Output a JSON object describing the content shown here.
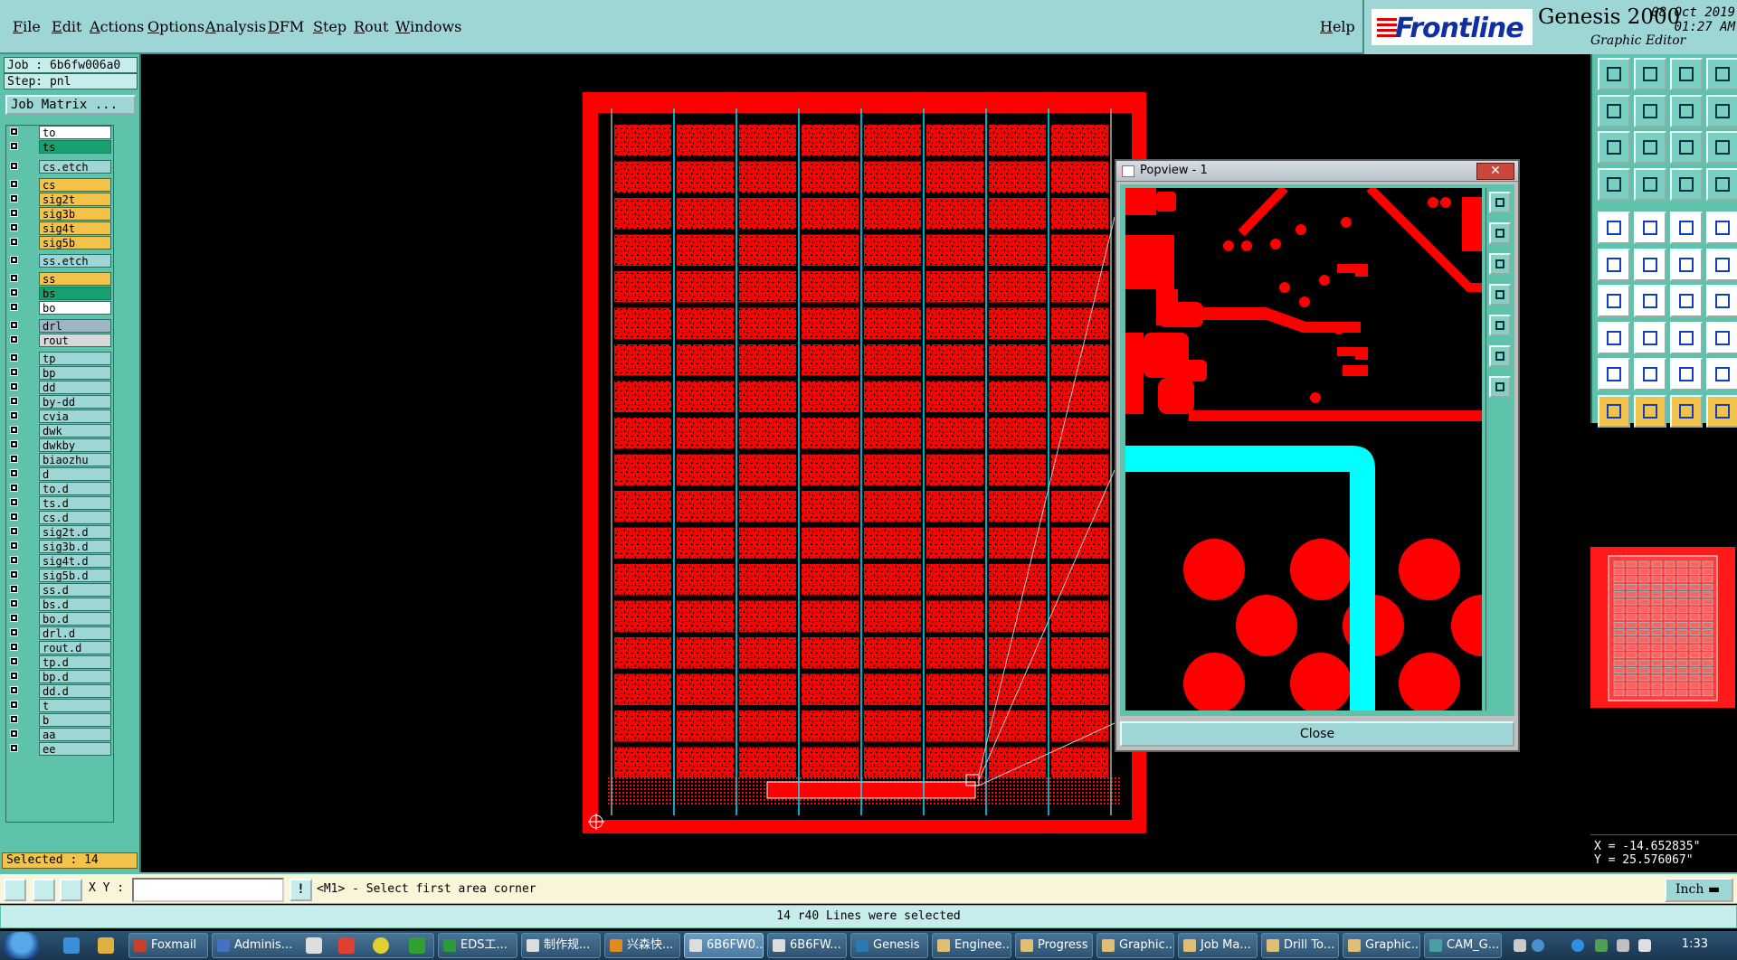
{
  "menu": {
    "items": [
      "File",
      "Edit",
      "Actions",
      "Options",
      "Analysis",
      "DFM",
      "Step",
      "Rout",
      "Windows"
    ],
    "help": "Help"
  },
  "brand": {
    "logo_text": "Frontline",
    "product": "Genesis 2000",
    "subtitle": "Graphic Editor",
    "date": "08 Oct 2019",
    "time": "01:27 AM"
  },
  "job": {
    "job_label": "Job : 6b6fw006a0",
    "step_label": "Step: pnl",
    "job_matrix_button": "Job Matrix ..."
  },
  "layers": [
    {
      "name": "to",
      "color": "#ffffff"
    },
    {
      "name": "ts",
      "color": "#1aa06e"
    },
    {
      "name": "cs.etch",
      "color": "#9ed6d6"
    },
    {
      "name": "cs",
      "color": "#f3c24b"
    },
    {
      "name": "sig2t",
      "color": "#f3c24b"
    },
    {
      "name": "sig3b",
      "color": "#f3c24b"
    },
    {
      "name": "sig4t",
      "color": "#f3c24b"
    },
    {
      "name": "sig5b",
      "color": "#f3c24b"
    },
    {
      "name": "ss.etch",
      "color": "#9ed6d6"
    },
    {
      "name": "ss",
      "color": "#f3c24b"
    },
    {
      "name": "bs",
      "color": "#1aa06e"
    },
    {
      "name": "bo",
      "color": "#ffffff"
    },
    {
      "name": "drl",
      "color": "#9fb7c4"
    },
    {
      "name": "rout",
      "color": "#d8d8d8"
    },
    {
      "name": "tp",
      "color": "#9ed6d6"
    },
    {
      "name": "bp",
      "color": "#9ed6d6"
    },
    {
      "name": "dd",
      "color": "#9ed6d6"
    },
    {
      "name": "by-dd",
      "color": "#9ed6d6"
    },
    {
      "name": "cvia",
      "color": "#9ed6d6"
    },
    {
      "name": "dwk",
      "color": "#9ed6d6"
    },
    {
      "name": "dwkby",
      "color": "#9ed6d6"
    },
    {
      "name": "biaozhu",
      "color": "#9ed6d6"
    },
    {
      "name": "d",
      "color": "#9ed6d6"
    },
    {
      "name": "to.d",
      "color": "#9ed6d6"
    },
    {
      "name": "ts.d",
      "color": "#9ed6d6"
    },
    {
      "name": "cs.d",
      "color": "#9ed6d6"
    },
    {
      "name": "sig2t.d",
      "color": "#9ed6d6"
    },
    {
      "name": "sig3b.d",
      "color": "#9ed6d6"
    },
    {
      "name": "sig4t.d",
      "color": "#9ed6d6"
    },
    {
      "name": "sig5b.d",
      "color": "#9ed6d6"
    },
    {
      "name": "ss.d",
      "color": "#9ed6d6"
    },
    {
      "name": "bs.d",
      "color": "#9ed6d6"
    },
    {
      "name": "bo.d",
      "color": "#9ed6d6"
    },
    {
      "name": "drl.d",
      "color": "#9ed6d6"
    },
    {
      "name": "rout.d",
      "color": "#9ed6d6"
    },
    {
      "name": "tp.d",
      "color": "#9ed6d6"
    },
    {
      "name": "bp.d",
      "color": "#9ed6d6"
    },
    {
      "name": "dd.d",
      "color": "#9ed6d6"
    },
    {
      "name": "t",
      "color": "#9ed6d6"
    },
    {
      "name": "b",
      "color": "#9ed6d6"
    },
    {
      "name": "aa",
      "color": "#9ed6d6"
    },
    {
      "name": "ee",
      "color": "#9ed6d6"
    }
  ],
  "selected_label": "Selected : 14",
  "popview": {
    "title": "Popview - 1",
    "close_label": "Close"
  },
  "coords": {
    "x": "X = -14.652835\"",
    "y": "Y = 25.576067\""
  },
  "command": {
    "xy_label": "X Y :",
    "xy_value": "",
    "prompt": "<M1> - Select first area corner",
    "units": "Inch"
  },
  "status": "14 r40 Lines were selected",
  "taskbar": {
    "tasks": [
      {
        "label": "Foxmail",
        "color": "#c8402a"
      },
      {
        "label": "Adminis...",
        "color": "#4470c8"
      },
      {
        "label": "EDS工...",
        "color": "#2a9a3a"
      },
      {
        "label": "制作规...",
        "color": "#dddddd"
      },
      {
        "label": "兴森快...",
        "color": "#e08a20"
      },
      {
        "label": "6B6FW0...",
        "color": "#dddddd"
      },
      {
        "label": "6B6FW...",
        "color": "#dddddd"
      },
      {
        "label": "Genesis",
        "color": "#2a7ab0"
      },
      {
        "label": "Enginee...",
        "color": "#e0c070"
      },
      {
        "label": "Progress",
        "color": "#e0c070"
      },
      {
        "label": "Graphic...",
        "color": "#e0c070"
      },
      {
        "label": "Job Ma...",
        "color": "#e0c070"
      },
      {
        "label": "Drill To...",
        "color": "#e0c070"
      },
      {
        "label": "Graphic...",
        "color": "#e0c070"
      },
      {
        "label": "CAM_G...",
        "color": "#4aa0a0"
      }
    ],
    "active_index": 5,
    "clock": "1:33"
  }
}
